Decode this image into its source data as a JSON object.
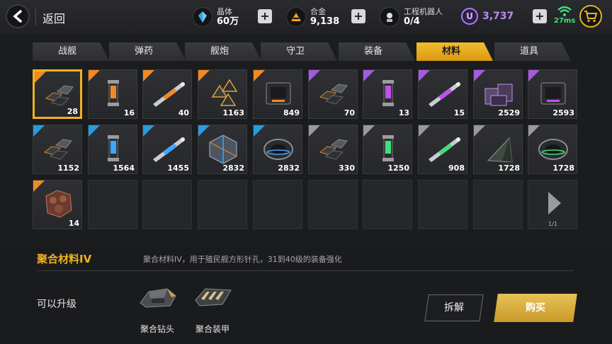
{
  "header": {
    "back_label": "返回",
    "resources": [
      {
        "label": "晶体",
        "value": "60万",
        "icon": "crystal-icon"
      },
      {
        "label": "合金",
        "value": "9,138",
        "icon": "alloy-icon"
      },
      {
        "label": "工程机器人",
        "value": "0/4",
        "icon": "robot-icon"
      }
    ],
    "u_currency": {
      "symbol": "U",
      "value": "3,737"
    },
    "ping": "27ms",
    "colors": {
      "accent": "#f0b21f",
      "ucoin": "#b88cf5",
      "ping": "#3fe07c"
    }
  },
  "tabs": [
    {
      "label": "战舰",
      "active": false
    },
    {
      "label": "弹药",
      "active": false
    },
    {
      "label": "舰炮",
      "active": false
    },
    {
      "label": "守卫",
      "active": false
    },
    {
      "label": "装备",
      "active": false
    },
    {
      "label": "材料",
      "active": true
    },
    {
      "label": "道具",
      "active": false
    }
  ],
  "rarity_colors": {
    "orange": "#f08a24",
    "purple": "#a45be0",
    "blue": "#2a9be0",
    "gray": "#9a9a9a"
  },
  "items": [
    {
      "count": "28",
      "rarity": "orange",
      "icon": "hex-plates-icon",
      "selected": true
    },
    {
      "count": "16",
      "rarity": "orange",
      "icon": "capsule-icon"
    },
    {
      "count": "40",
      "rarity": "orange",
      "icon": "rod-icon"
    },
    {
      "count": "1163",
      "rarity": "orange",
      "icon": "crystal-cluster-icon"
    },
    {
      "count": "849",
      "rarity": "orange",
      "icon": "engine-block-icon"
    },
    {
      "count": "70",
      "rarity": "purple",
      "icon": "hex-plates-icon"
    },
    {
      "count": "13",
      "rarity": "purple",
      "icon": "capsule-icon"
    },
    {
      "count": "15",
      "rarity": "purple",
      "icon": "rod-icon"
    },
    {
      "count": "2529",
      "rarity": "purple",
      "icon": "cube-cluster-icon"
    },
    {
      "count": "2593",
      "rarity": "purple",
      "icon": "engine-block-icon"
    },
    {
      "count": "1152",
      "rarity": "blue",
      "icon": "hex-plates-icon"
    },
    {
      "count": "1564",
      "rarity": "blue",
      "icon": "capsule-icon"
    },
    {
      "count": "1455",
      "rarity": "blue",
      "icon": "rod-icon"
    },
    {
      "count": "2832",
      "rarity": "blue",
      "icon": "cube-icon"
    },
    {
      "count": "2832",
      "rarity": "blue",
      "icon": "ring-core-icon"
    },
    {
      "count": "330",
      "rarity": "gray",
      "icon": "hex-plates-icon"
    },
    {
      "count": "1250",
      "rarity": "gray",
      "icon": "capsule-icon"
    },
    {
      "count": "908",
      "rarity": "gray",
      "icon": "rod-icon"
    },
    {
      "count": "1728",
      "rarity": "gray",
      "icon": "pyramid-icon"
    },
    {
      "count": "1728",
      "rarity": "gray",
      "icon": "ring-core-icon"
    },
    {
      "count": "14",
      "rarity": "orange",
      "icon": "armor-chunk-icon"
    }
  ],
  "pagination": "1/1",
  "detail": {
    "name": "聚合材料IV",
    "description": "聚合材料IV，用于殖民舰方形针孔，31到40级的装备强化",
    "upgrade_label": "可以升级",
    "upgrades": [
      {
        "name": "聚合钻头",
        "icon": "drill-icon"
      },
      {
        "name": "聚合装甲",
        "icon": "armor-icon"
      }
    ],
    "dismantle_label": "拆解",
    "buy_label": "购买"
  }
}
